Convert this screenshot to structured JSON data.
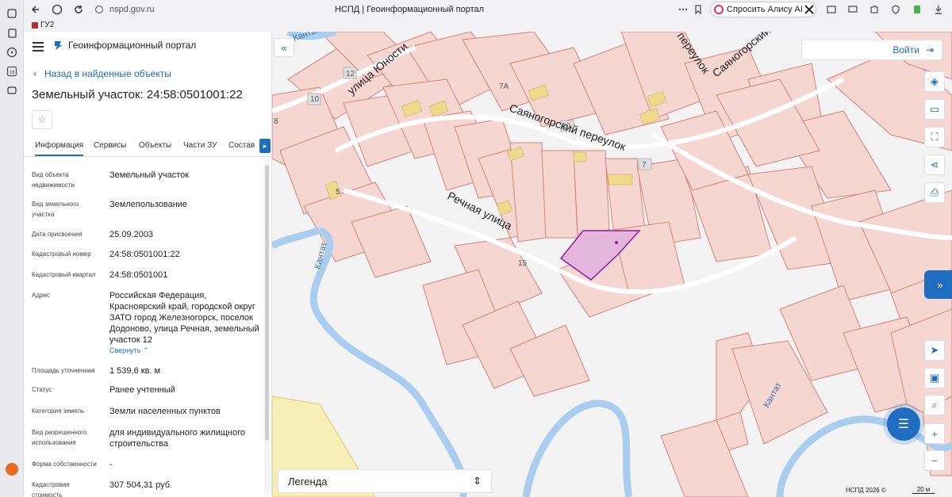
{
  "browser": {
    "url": "nspd.gov.ru",
    "tab_title": "НСПД | Геоинформационный портал",
    "alice_label": "Спросить Алису AI",
    "bookmark": "ГУ2",
    "vtab_icons": [
      "tabs-icon",
      "history-icon",
      "play-icon",
      "calendar-18-icon",
      "screen-icon"
    ],
    "ext_icons": [
      "translate-icon",
      "ext-image-icon",
      "monitor-icon",
      "puzzle-icon",
      "ext-shield-icon",
      "ext-green-icon",
      "download-icon"
    ]
  },
  "panel": {
    "portal_name": "Геоинформационный портал",
    "back_label": "Назад в найденные объекты",
    "object_title": "Земельный участок: 24:58:0501001:22",
    "tabs": [
      "Информация",
      "Сервисы",
      "Объекты",
      "Части ЗУ",
      "Состав"
    ],
    "collapse_label": "Свернуть",
    "rows": [
      {
        "key": "Вид объекта недвижимости",
        "value": "Земельный участок"
      },
      {
        "key": "Вид земельного участка",
        "value": "Землепользование"
      },
      {
        "key": "Дата присвоения",
        "value": "25.09.2003"
      },
      {
        "key": "Кадастровый номер",
        "value": "24:58:0501001:22"
      },
      {
        "key": "Кадастровый квартал",
        "value": "24:58:0501001"
      },
      {
        "key": "Адрес",
        "value": "Российская Федерация, Красноярский край, городской округ ЗАТО город Железногорск, поселок Додоново, улица Речная, земельный участок 12"
      },
      {
        "key": "Площадь уточненная",
        "value": "1 539,6 кв. м"
      },
      {
        "key": "Статус",
        "value": "Ранее учтенный"
      },
      {
        "key": "Категория земель",
        "value": "Земли населенных пунктов"
      },
      {
        "key": "Вид разрешенного использования",
        "value": "для индивидуального жилищного строительства"
      },
      {
        "key": "Форма собственности",
        "value": "-"
      },
      {
        "key": "Кадастровая стоимость",
        "value": "307 504,31 руб."
      }
    ]
  },
  "map": {
    "login_label": "Войти",
    "legend_label": "Легенда",
    "copyright": "НСПД 2026 ©",
    "scale_label": "20 м",
    "streets": {
      "yunosti": "улица Юности",
      "sayanogorsky": "Саяногорский переулок",
      "sayanogorsky_top": "Саяногорский",
      "pereulok": "переулок",
      "rechnaya": "Речная улица",
      "kantat1": "Кантат",
      "kantat2": "Кантат",
      "kantat_top": "Кантат"
    },
    "house_numbers": [
      "12",
      "10",
      "8",
      "7А",
      "10",
      "7",
      "5",
      "15"
    ],
    "tools": [
      "layers-icon",
      "ruler-icon",
      "select-area-icon",
      "share-icon",
      "print-icon",
      "locate-icon",
      "basemap-icon",
      "search-map-icon",
      "zoom-in-icon",
      "zoom-out-icon"
    ]
  },
  "colors": {
    "accent": "#1f6dc0",
    "parcel_fill": "#f5d6d0",
    "parcel_stroke": "#d9827a",
    "selected_fill": "#e4b6dc",
    "selected_stroke": "#8a1fa0",
    "river": "#a9cdef",
    "road": "#ffffff",
    "building": "#efd98a"
  }
}
